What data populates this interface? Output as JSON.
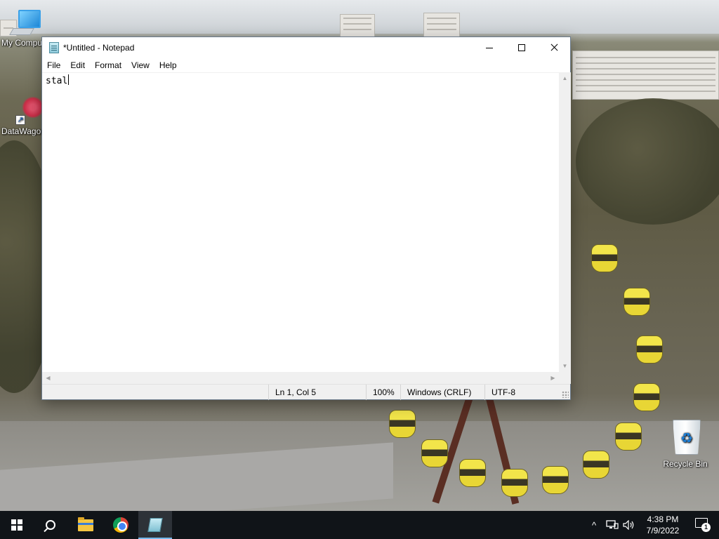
{
  "desktop": {
    "icons": [
      {
        "label": "My Computer",
        "icon": "computer-icon"
      },
      {
        "label": "DataWagon",
        "icon": "datawagon-icon"
      },
      {
        "label": "Recycle Bin",
        "icon": "recycle-bin-icon"
      }
    ]
  },
  "window": {
    "title": "*Untitled - Notepad",
    "app_icon": "notepad-icon",
    "controls": {
      "minimize": "minimize-icon",
      "maximize": "maximize-icon",
      "close": "close-icon"
    },
    "menu": [
      "File",
      "Edit",
      "Format",
      "View",
      "Help"
    ],
    "editor_text": "stal",
    "status": {
      "position": "Ln 1, Col 5",
      "zoom": "100%",
      "line_ending": "Windows (CRLF)",
      "encoding": "UTF-8"
    }
  },
  "taskbar": {
    "pinned": [
      "windows-start-icon",
      "search-icon",
      "file-explorer-icon",
      "chrome-icon",
      "notepad-icon"
    ],
    "tray": {
      "chevron": "^",
      "time": "4:38 PM",
      "date": "7/9/2022",
      "notification_count": "1"
    }
  },
  "colors": {
    "taskbar_bg": "#101418",
    "taskbar_active_underline": "#76b9ed",
    "statusbar_bg": "#f0f0f0"
  }
}
